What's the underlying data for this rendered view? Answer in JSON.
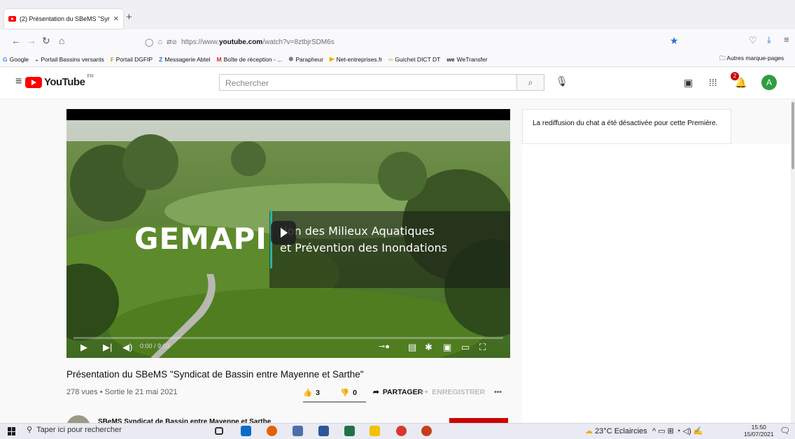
{
  "browser": {
    "tab_title": "(2) Présentation du SBeMS \"Syn",
    "tab_close": "✕",
    "new_tab": "+",
    "url_prefix": "https://www.",
    "url_domain": "youtube.com",
    "url_path": "/watch?v=8ztbjrSDM6s",
    "bookmarks": [
      {
        "icon": "G",
        "label": "Google",
        "color": "#4285f4"
      },
      {
        "icon": "◒",
        "label": "Portail Bassins versants",
        "color": "#2a7ab9"
      },
      {
        "icon": "₣",
        "label": "Portail DGFIP",
        "color": "#d4a017"
      },
      {
        "icon": "Z",
        "label": "Messagerie Abtel",
        "color": "#2b73d9"
      },
      {
        "icon": "M",
        "label": "Boîte de réception - ...",
        "color": "#d93025"
      },
      {
        "icon": "⊕",
        "label": "Parapheur",
        "color": "#555"
      },
      {
        "icon": "▶",
        "label": "Net-entreprises.fr",
        "color": "#f2a900"
      },
      {
        "icon": "═",
        "label": "Guichet DICT DT",
        "color": "#e8a33a"
      },
      {
        "icon": "we",
        "label": "WeTransfer",
        "color": "#222"
      }
    ],
    "other_bookmarks": "Autres marque-pages"
  },
  "youtube": {
    "logo": "YouTube",
    "region": "FR",
    "search_placeholder": "Rechercher",
    "notif_count": "2",
    "avatar_letter": "A"
  },
  "video": {
    "overlay_title": "GEMAPI",
    "overlay_line1": "tion des Milieux Aquatiques",
    "overlay_line2": "et Prévention des Inondations",
    "timecode": "0:00 / 9:03",
    "progress": 0.0,
    "title": "Présentation du SBeMS \"Syndicat de Bassin entre Mayenne et Sarthe\"",
    "stats": "278 vues • Sortie le 21 mai 2021",
    "likes": "3",
    "dislikes": "0",
    "share": "PARTAGER",
    "save": "ENREGISTRER",
    "channel": "SBeMS Syndicat de Bassin entre Mayenne et Sarthe"
  },
  "chat": {
    "message": "La rediffusion du chat a été désactivée pour cette Première."
  },
  "taskbar": {
    "search": "Taper ici pour rechercher",
    "weather": "23°C Eclaircies",
    "time": "15:50",
    "date": "15/07/2021"
  }
}
